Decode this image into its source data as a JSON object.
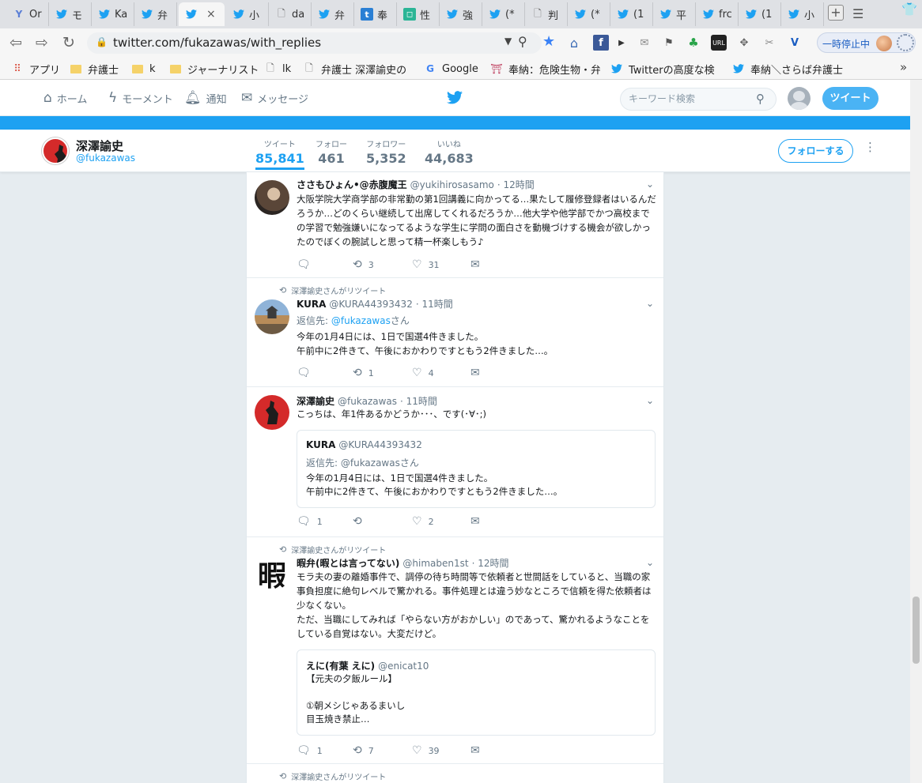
{
  "browser": {
    "tabs": [
      {
        "label": "Or",
        "icon": "y-icon"
      },
      {
        "label": "モ",
        "icon": "twitter-bird-icon"
      },
      {
        "label": "Ka",
        "icon": "twitter-bird-icon"
      },
      {
        "label": "弁",
        "icon": "twitter-bird-icon"
      },
      {
        "label": "",
        "icon": "twitter-bird-icon",
        "active": true,
        "close": "×"
      },
      {
        "label": "小",
        "icon": "twitter-bird-icon"
      },
      {
        "label": "da",
        "icon": "page-icon"
      },
      {
        "label": "弁",
        "icon": "twitter-bird-icon"
      },
      {
        "label": "奉",
        "icon": "blue-t-icon"
      },
      {
        "label": "性",
        "icon": "green-square-icon"
      },
      {
        "label": "強",
        "icon": "twitter-bird-icon"
      },
      {
        "label": "(*",
        "icon": "twitter-bird-icon"
      },
      {
        "label": "判",
        "icon": "page-icon"
      },
      {
        "label": "(*",
        "icon": "twitter-bird-icon"
      },
      {
        "label": "(1",
        "icon": "twitter-bird-icon"
      },
      {
        "label": "平",
        "icon": "twitter-bird-icon"
      },
      {
        "label": "frc",
        "icon": "twitter-bird-icon"
      },
      {
        "label": "(1",
        "icon": "twitter-bird-icon"
      },
      {
        "label": "小",
        "icon": "twitter-bird-icon"
      }
    ],
    "url": "twitter.com/fukazawas/with_replies",
    "pause_label": "一時停止中",
    "bookmarks": [
      {
        "label": "アプリ",
        "icon": "apps-grid-icon"
      },
      {
        "label": "弁護士",
        "icon": "folder-icon"
      },
      {
        "label": "k",
        "icon": "folder-icon"
      },
      {
        "label": "ジャーナリスト",
        "icon": "folder-icon"
      },
      {
        "label": "lk",
        "icon": "page-icon"
      },
      {
        "label": "弁護士 深澤諭史の",
        "icon": "page-icon"
      },
      {
        "label": "Google",
        "icon": "google-g-icon"
      },
      {
        "label": "奉納：危険生物・弁",
        "icon": "shrine-icon"
      },
      {
        "label": "Twitterの高度な検",
        "icon": "twitter-bird-icon"
      },
      {
        "label": "奉納＼さらば弁護士",
        "icon": "twitter-bird-icon"
      }
    ]
  },
  "twitter_nav": {
    "home": "ホーム",
    "moments": "モーメント",
    "notifications": "通知",
    "messages": "メッセージ",
    "search_placeholder": "キーワード検索",
    "tweet_button": "ツイート"
  },
  "profile": {
    "name": "深澤諭史",
    "handle": "@fukazawas",
    "stats": [
      {
        "label": "ツイート",
        "value": "85,841",
        "active": true
      },
      {
        "label": "フォロー",
        "value": "461"
      },
      {
        "label": "フォロワー",
        "value": "5,352"
      },
      {
        "label": "いいね",
        "value": "44,683"
      }
    ],
    "follow_button": "フォローする"
  },
  "timeline": {
    "retweet_context": "深澤諭史さんがリツイート",
    "tweets": [
      {
        "name": "ささもひょん•@赤腹魔王",
        "handle": "@yukihirosasamo",
        "time": "· 12時間",
        "text": "大阪学院大学商学部の非常勤の第1回講義に向かってる…果たして履修登録者はいるんだろうか…どのくらい継続して出席してくれるだろうか…他大学や他学部でかつ高校までの学習で勉強嫌いになってるような学生に学問の面白さを動機づけする機会が欲しかったのでぼくの腕試しと思って精一杯楽しもう♪",
        "replies": "",
        "retweets": "3",
        "likes": "31"
      },
      {
        "name": "KURA",
        "handle": "@KURA44393432",
        "time": "· 11時間",
        "reply_prefix": "返信先: ",
        "reply_handle": "@fukazawas",
        "reply_suffix": "さん",
        "text": "今年の1月4日には、1日で国選4件きました。\n午前中に2件きて、午後におかわりですともう2件きました…。",
        "replies": "",
        "retweets": "1",
        "likes": "4"
      },
      {
        "name": "深澤諭史",
        "handle": "@fukazawas",
        "time": "· 11時間",
        "text": "こっちは、年1件あるかどうか･･･、です(･∀･;)",
        "quote": {
          "name": "KURA",
          "handle": "@KURA44393432",
          "reply": "返信先: @fukazawasさん",
          "text": "今年の1月4日には、1日で国選4件きました。\n午前中に2件きて、午後におかわりですともう2件きました…。"
        },
        "replies": "1",
        "retweets": "",
        "likes": "2"
      },
      {
        "name": "暇弁(暇とは言ってない)",
        "handle": "@himaben1st",
        "time": "· 12時間",
        "avatar_text": "暇",
        "text": "モラ夫の妻の離婚事件で、調停の待ち時間等で依頼者と世間話をしていると、当職の家事負担度に絶句レベルで驚かれる。事件処理とは違う妙なところで信頼を得た依頼者は少なくない。\nただ、当職にしてみれば「やらない方がおかしい」のであって、驚かれるようなことをしている自覚はない。大変だけど。",
        "quote": {
          "name": "えに(有葉 えに)",
          "handle": "@enicat10",
          "text": "【元夫の夕飯ルール】\n\n①朝メシじゃあるまいし\n目玉焼き禁止…"
        },
        "replies": "1",
        "retweets": "7",
        "likes": "39"
      }
    ]
  },
  "colors": {
    "twitter_blue": "#1da1f2",
    "tweet_button": "#4ab3f4"
  }
}
